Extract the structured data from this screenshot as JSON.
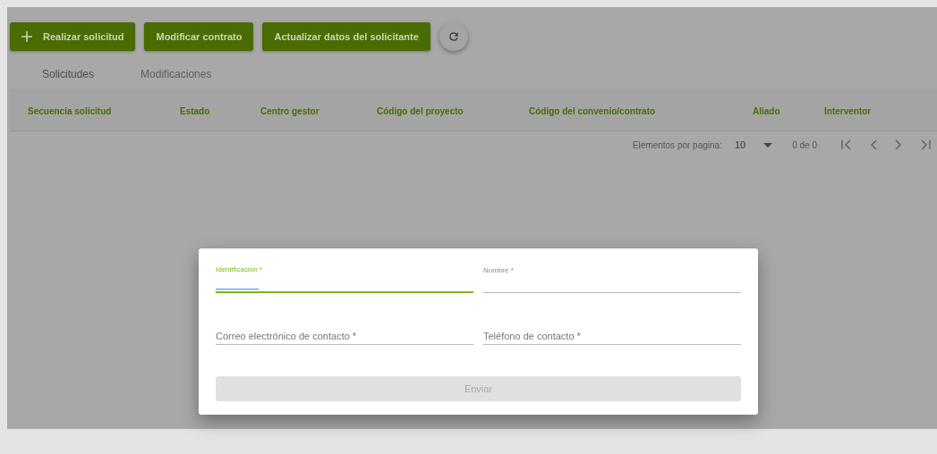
{
  "toolbar": {
    "buttons": [
      {
        "label": "Realizar solicitud",
        "kind": "with-icon"
      },
      {
        "label": "Modificar contrato",
        "kind": "plain"
      },
      {
        "label": "Actualizar datos del solicitante",
        "kind": "plain"
      }
    ]
  },
  "tabs": [
    {
      "label": "Solicitudes",
      "selected": true
    },
    {
      "label": "Modificaciones",
      "selected": false
    }
  ],
  "table": {
    "columns": [
      "Secuencia solicitud",
      "Estado",
      "Centro gestor",
      "Código del proyecto",
      "Código del convenio/contrato",
      "Aliado",
      "Interventor"
    ]
  },
  "paginator": {
    "label": "Elementos por pagina:",
    "page_size": "10",
    "range": "0 de 0"
  },
  "dialog": {
    "fields": [
      {
        "label": "Identificación *",
        "focused": true,
        "floated": true
      },
      {
        "label": "Nombre *",
        "focused": false,
        "floated": true
      },
      {
        "label": "Correo electrónico de contacto *",
        "focused": false,
        "floated": false
      },
      {
        "label": "Teléfono de contacto *",
        "focused": false,
        "floated": false
      }
    ],
    "submit": {
      "label": "Enviar",
      "disabled": true
    }
  }
}
